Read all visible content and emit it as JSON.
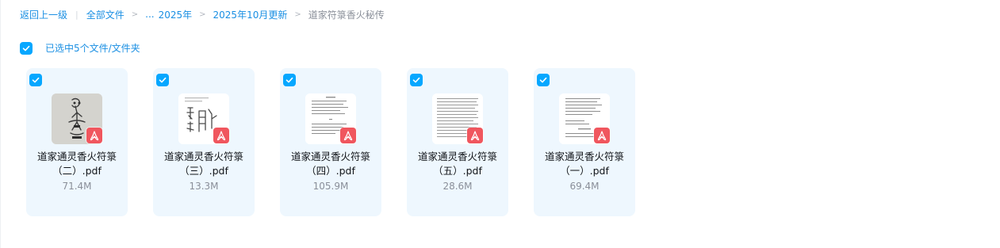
{
  "breadcrumb": {
    "back": "返回上一级",
    "all_files": "全部文件",
    "ellipsis": "...",
    "year": "2025年",
    "month": "2025年10月更新",
    "current": "道家符箓香火秘传"
  },
  "selection": {
    "label": "已选中5个文件/文件夹"
  },
  "files": [
    {
      "name_line1": "道家通灵香火符箓",
      "name_line2": "（二）.pdf",
      "size": "71.4M",
      "thumbnail_icon": "figure-drawing-thumbnail-icon"
    },
    {
      "name_line1": "道家通灵香火符箓",
      "name_line2": "（三）.pdf",
      "size": "13.3M",
      "thumbnail_icon": "talisman-script-thumbnail-icon"
    },
    {
      "name_line1": "道家通灵香火符箓",
      "name_line2": "（四）.pdf",
      "size": "105.9M",
      "thumbnail_icon": "text-page-thumbnail-icon"
    },
    {
      "name_line1": "道家通灵香火符箓",
      "name_line2": "（五）.pdf",
      "size": "28.6M",
      "thumbnail_icon": "text-page-thumbnail-icon"
    },
    {
      "name_line1": "道家通灵香火符箓",
      "name_line2": "（一）.pdf",
      "size": "69.4M",
      "thumbnail_icon": "text-page-thumbnail-icon"
    }
  ],
  "colors": {
    "accent": "#06a7ff",
    "link": "#1a8fe3",
    "card_bg": "#eef7fe",
    "pdf_badge": "#f0565e"
  }
}
